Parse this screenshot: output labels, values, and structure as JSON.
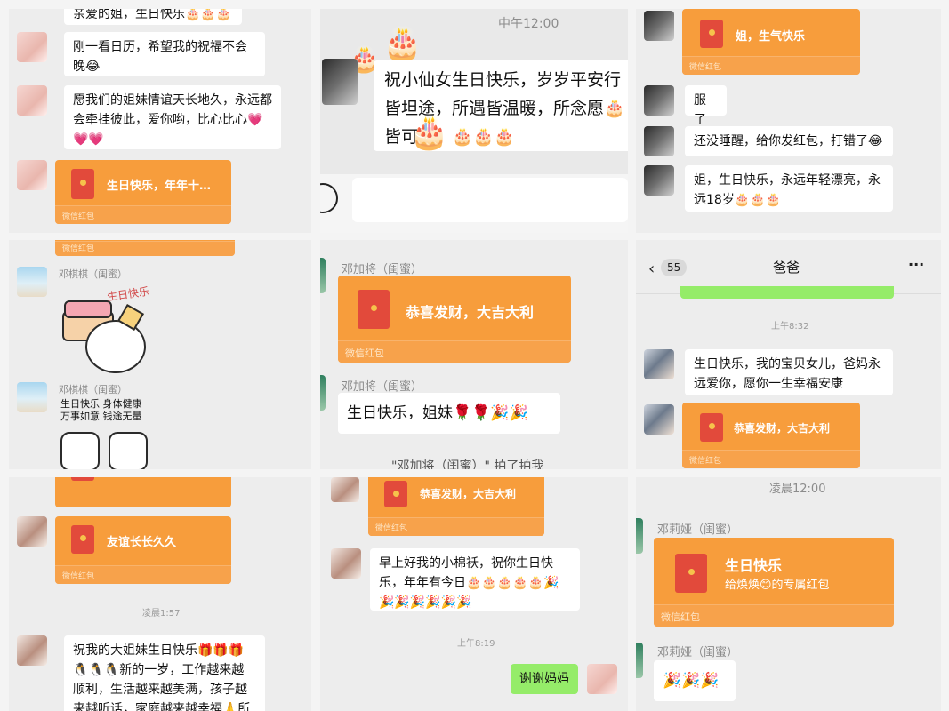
{
  "p1": {
    "msg_top": "亲爱的姐，生日快乐🎂🎂🎂",
    "msg1": "刚一看日历，希望我的祝福不会晚😂",
    "msg2": "愿我们的姐妹情谊天长地久，永远都会牵挂彼此，爱你哟，比心比心💗💗💗",
    "rp_title": "生日快乐，年年十…",
    "rp_footer": "微信红包"
  },
  "p2": {
    "time": "中午12:00",
    "msg": "祝小仙女生日快乐，岁岁平安行皆坦途，所遇皆温暖，所念愿🎂皆可期！🎂🎂🎂"
  },
  "p3": {
    "rp_title": "姐，生气快乐",
    "rp_footer": "微信红包",
    "msg1": "服了",
    "msg2": "还没睡醒，给你发红包，打错了😂",
    "msg3": "姐，生日快乐，永远年轻漂亮，永远18岁🎂🎂🎂"
  },
  "p4": {
    "rp_footer_partial": "微信红包",
    "name1": "邓棋棋（闺蜜）",
    "sticker1_text": "生日快乐",
    "name2": "邓棋棋（闺蜜）",
    "sticker2_text": "生日快乐 身体健康 万事如意 钱途无量"
  },
  "p5": {
    "name1": "邓加将（闺蜜）",
    "rp_title": "恭喜发财，大吉大利",
    "rp_footer": "微信红包",
    "name2": "邓加将（闺蜜）",
    "msg": "生日快乐，姐妹🌹🌹🎉🎉",
    "pat": "\"邓加将（闺蜜）\" 拍了拍我"
  },
  "p6": {
    "back_count": "55",
    "title": "爸爸",
    "more": "···",
    "time": "上午8:32",
    "msg": "生日快乐，我的宝贝女儿，爸妈永远爱你，愿你一生幸福安康",
    "rp_title": "恭喜发财，大吉大利",
    "rp_footer": "微信红包"
  },
  "p7": {
    "rp_title": "友谊长长久久",
    "rp_footer": "微信红包",
    "time": "凌晨1:57",
    "msg": "祝我的大姐妹生日快乐🎁🎁🎁🐧🐧🐧新的一岁，工作越来越顺利，生活越来越美满，孩子越来越听话，家庭越来越幸福🙏所有美好都属于"
  },
  "p8": {
    "rp_title": "恭喜发财，大吉大利",
    "rp_footer": "微信红包",
    "msg": "早上好我的小棉袄，祝你生日快乐，年年有今日🎂🎂🎂🎂🎂🎉🎉🎉🎉🎉🎉🎉",
    "time": "上午8:19",
    "reply": "谢谢妈妈"
  },
  "p9": {
    "time": "凌晨12:00",
    "name1": "邓莉娅（闺蜜）",
    "rp_title": "生日快乐",
    "rp_sub": "给焕焕😊的专属红包",
    "rp_footer": "微信红包",
    "name2": "邓莉娅（闺蜜）",
    "msg": "🎉🎉🎉"
  }
}
